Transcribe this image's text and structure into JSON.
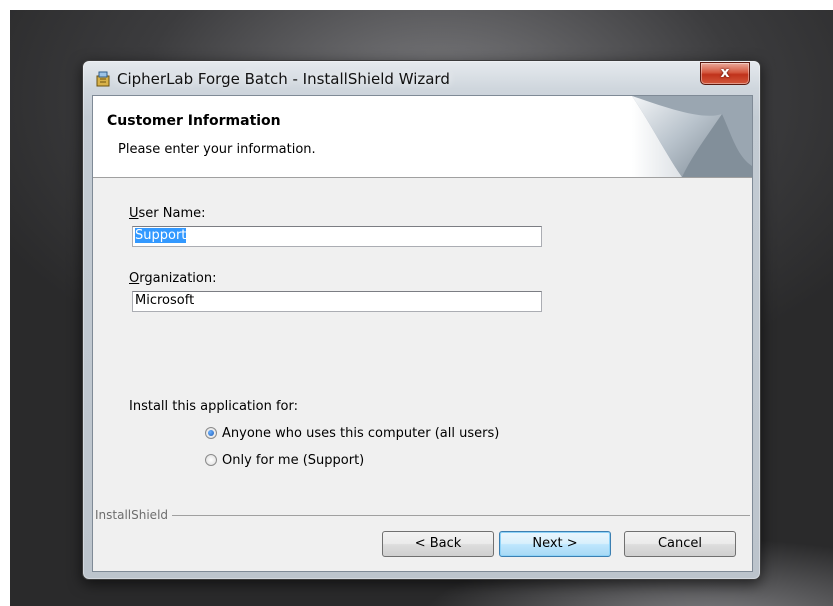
{
  "window": {
    "title": "CipherLab Forge Batch - InstallShield Wizard",
    "close_glyph": "x",
    "icon": "installer-icon"
  },
  "header": {
    "title": "Customer Information",
    "subtitle": "Please enter your information."
  },
  "form": {
    "user_name": {
      "label_accel": "U",
      "label_rest": "ser Name:",
      "value": "Support"
    },
    "organization": {
      "label_accel": "O",
      "label_rest": "rganization:",
      "value": "Microsoft"
    },
    "install_for_label": "Install this application for:",
    "options": [
      {
        "label": "Anyone who uses this computer (all users)",
        "checked": true
      },
      {
        "label": "Only for me (Support)",
        "checked": false
      }
    ]
  },
  "footer": {
    "brand": "InstallShield",
    "back_label": "< Back",
    "next_label": "Next >",
    "cancel_label": "Cancel"
  },
  "colors": {
    "selection": "#3399ff",
    "close_button": "#c0321b",
    "default_button_border": "#3c7fb1"
  }
}
